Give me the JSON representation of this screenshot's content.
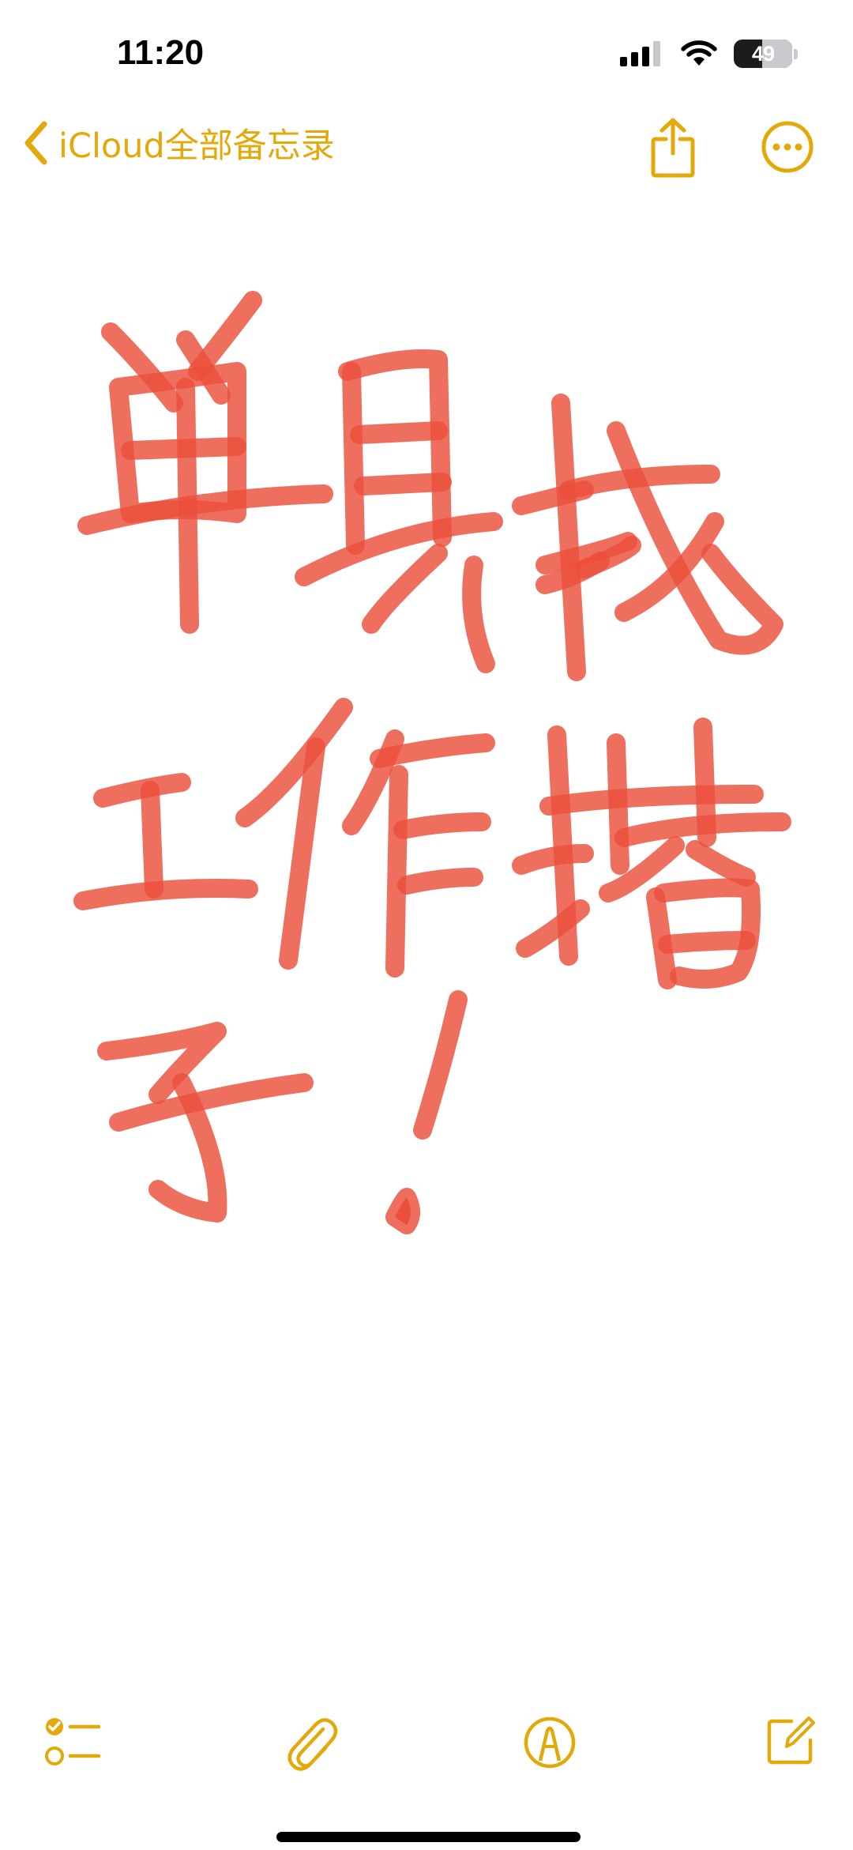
{
  "status_bar": {
    "time": "11:20",
    "battery_percent": "49",
    "battery_level": 0.49,
    "icons": [
      "cellular-signal-icon",
      "wifi-icon",
      "battery-icon"
    ]
  },
  "nav": {
    "back_label": "iCloud全部备忘录",
    "icons": [
      "chevron-left-icon",
      "share-icon",
      "more-icon"
    ]
  },
  "note": {
    "content_type": "handwritten drawing",
    "ink_color": "#ec4f3c"
  },
  "toolbar": {
    "icons": [
      "checklist-icon",
      "paperclip-icon",
      "markup-pen-icon",
      "compose-icon"
    ]
  },
  "theme": {
    "accent": "#e3a90b",
    "background": "#ffffff"
  }
}
